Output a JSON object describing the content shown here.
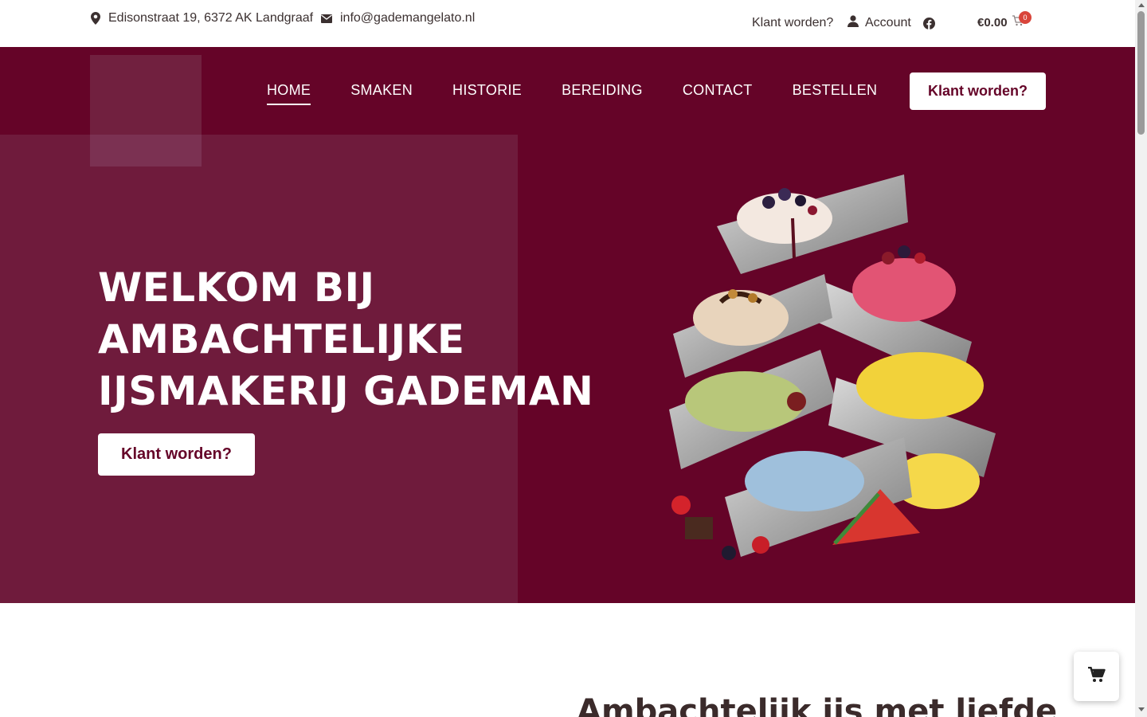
{
  "topbar": {
    "address": "Edisonstraat 19, 6372 AK Landgraaf",
    "email": "info@gademangelato.nl",
    "klant_link": "Klant worden?",
    "account_label": "Account",
    "cart_total": "€0.00",
    "cart_count": "0"
  },
  "nav": {
    "items": [
      {
        "label": "HOME",
        "active": true
      },
      {
        "label": "SMAKEN"
      },
      {
        "label": "HISTORIE"
      },
      {
        "label": "BEREIDING"
      },
      {
        "label": "CONTACT"
      },
      {
        "label": "BESTELLEN"
      }
    ],
    "cta_label": "Klant worden?"
  },
  "hero": {
    "title_line1": "WELKOM BIJ",
    "title_line2": "AMBACHTELIJKE",
    "title_line3": "IJSMAKERIJ GADEMAN",
    "cta_label": "Klant worden?"
  },
  "section": {
    "heading": "Ambachtelijk ijs met liefde"
  },
  "colors": {
    "brand": "#650428",
    "panel": "#6f1b3c",
    "badge": "#d9453b"
  }
}
